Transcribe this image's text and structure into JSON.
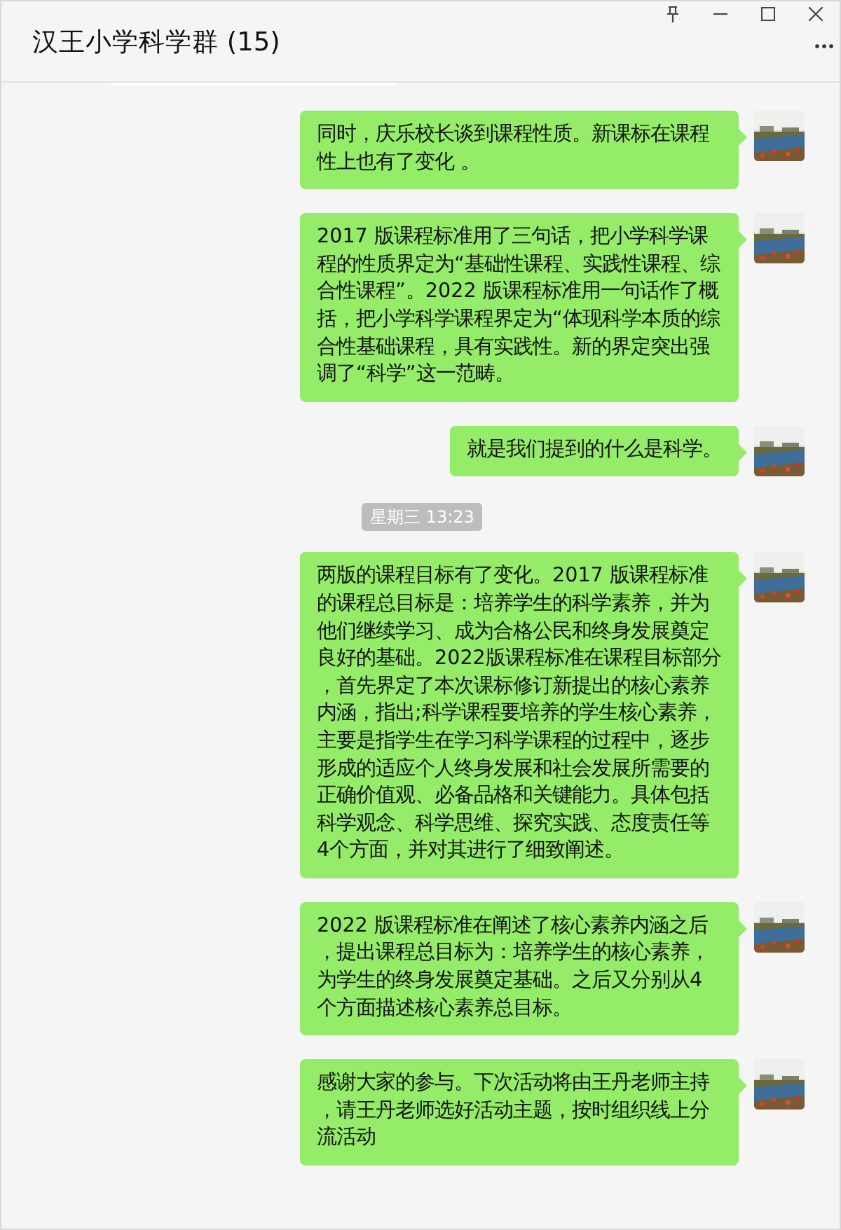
{
  "window": {
    "title": "汉王小学科学群 (15)"
  },
  "messages": [
    {
      "kind": "message",
      "text": "同时，庆乐校长谈到课程性质。新课标在课程性上也有了变化 。"
    },
    {
      "kind": "message",
      "text": "2017 版课程标准用了三句话，把小学科学课程的性质界定为“基础性课程、实践性课程、综合性课程”。2022 版课程标准用一句话作了概括，把小学科学课程界定为“体现科学本质的综合性基础课程，具有实践性。新的界定突出强调了“科学”这一范畴。"
    },
    {
      "kind": "message",
      "text": "就是我们提到的什么是科学。"
    },
    {
      "kind": "timestamp",
      "text": "星期三 13:23"
    },
    {
      "kind": "message",
      "text": "两版的课程目标有了变化。2017 版课程标准的课程总目标是：培养学生的科学素养，并为他们继续学习、成为合格公民和终身发展奠定良好的基础。2022版课程标准在课程目标部分，首先界定了本次课标修订新提出的核心素养内涵，指出;科学课程要培养的学生核心素养，主要是指学生在学习科学课程的过程中，逐步形成的适应个人终身发展和社会发展所需要的正确价值观、必备品格和关键能力。具体包括科学观念、科学思维、探究实践、态度责任等4个方面，并对其进行了细致阐述。"
    },
    {
      "kind": "message",
      "text": "2022 版课程标准在阐述了核心素养内涵之后，提出课程总目标为：培养学生的核心素养，为学生的终身发展奠定基础。之后又分别从4个方面描述核心素养总目标。"
    },
    {
      "kind": "message",
      "text": "感谢大家的参与。下次活动将由王丹老师主持，请王丹老师选好活动主题，按时组织线上分流活动"
    }
  ]
}
